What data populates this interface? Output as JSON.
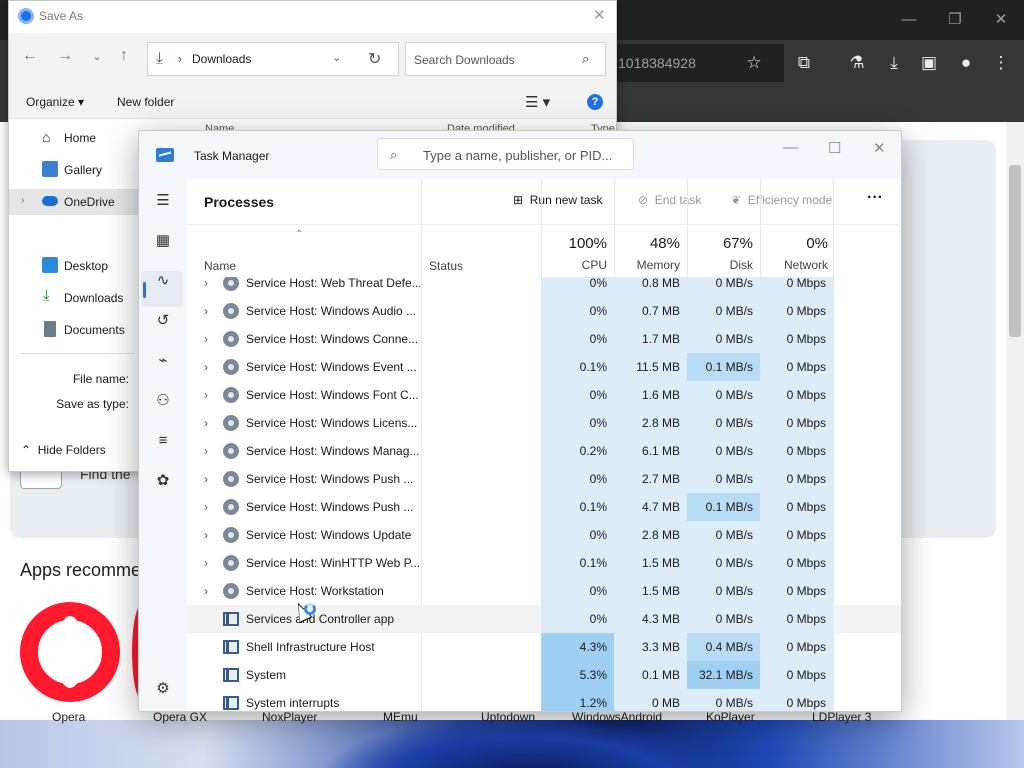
{
  "chrome": {
    "omnibox_text": "1018384928",
    "find_text": "Find the",
    "apps_heading": "Apps recomme",
    "apps": [
      "Opera",
      "Opera GX",
      "NoxPlayer",
      "MEmu",
      "Uptodown",
      "WindowsAndroid",
      "KoPlayer",
      "LDPlayer 3"
    ]
  },
  "save_as": {
    "title": "Save As",
    "path": "Downloads",
    "search_placeholder": "Search Downloads",
    "organize": "Organize",
    "new_folder": "New folder",
    "columns": [
      "Name",
      "Date modified",
      "Type"
    ],
    "sidebar": [
      {
        "label": "Home"
      },
      {
        "label": "Gallery"
      },
      {
        "label": "OneDrive"
      },
      {
        "label": "Desktop"
      },
      {
        "label": "Downloads"
      },
      {
        "label": "Documents"
      }
    ],
    "file_name_label": "File name:",
    "save_as_type_label": "Save as type:",
    "hide_folders": "Hide Folders"
  },
  "task_manager": {
    "title": "Task Manager",
    "search_placeholder": "Type a name, publisher, or PID...",
    "heading": "Processes",
    "run_new_task": "Run new task",
    "end_task": "End task",
    "efficiency_mode": "Efficiency mode",
    "columns": {
      "name": "Name",
      "status": "Status",
      "cpu_pct": "100%",
      "cpu": "CPU",
      "memory_pct": "48%",
      "memory": "Memory",
      "disk_pct": "67%",
      "disk": "Disk",
      "network_pct": "0%",
      "network": "Network"
    },
    "rows": [
      {
        "name": "Service Host: Web Threat Defe...",
        "cpu": "0%",
        "memory": "0.8 MB",
        "disk": "0 MB/s",
        "network": "0 Mbps",
        "group": true
      },
      {
        "name": "Service Host: Windows Audio ...",
        "cpu": "0%",
        "memory": "0.7 MB",
        "disk": "0 MB/s",
        "network": "0 Mbps",
        "group": true
      },
      {
        "name": "Service Host: Windows Conne...",
        "cpu": "0%",
        "memory": "1.7 MB",
        "disk": "0 MB/s",
        "network": "0 Mbps",
        "group": true
      },
      {
        "name": "Service Host: Windows Event ...",
        "cpu": "0.1%",
        "memory": "11.5 MB",
        "disk": "0.1 MB/s",
        "network": "0 Mbps",
        "group": true
      },
      {
        "name": "Service Host: Windows Font C...",
        "cpu": "0%",
        "memory": "1.6 MB",
        "disk": "0 MB/s",
        "network": "0 Mbps",
        "group": true
      },
      {
        "name": "Service Host: Windows Licens...",
        "cpu": "0%",
        "memory": "2.8 MB",
        "disk": "0 MB/s",
        "network": "0 Mbps",
        "group": true
      },
      {
        "name": "Service Host: Windows Manag...",
        "cpu": "0.2%",
        "memory": "6.1 MB",
        "disk": "0 MB/s",
        "network": "0 Mbps",
        "group": true
      },
      {
        "name": "Service Host: Windows Push ...",
        "cpu": "0%",
        "memory": "2.7 MB",
        "disk": "0 MB/s",
        "network": "0 Mbps",
        "group": true
      },
      {
        "name": "Service Host: Windows Push ...",
        "cpu": "0.1%",
        "memory": "4.7 MB",
        "disk": "0.1 MB/s",
        "network": "0 Mbps",
        "group": true
      },
      {
        "name": "Service Host: Windows Update",
        "cpu": "0%",
        "memory": "2.8 MB",
        "disk": "0 MB/s",
        "network": "0 Mbps",
        "group": true
      },
      {
        "name": "Service Host: WinHTTP Web P...",
        "cpu": "0.1%",
        "memory": "1.5 MB",
        "disk": "0 MB/s",
        "network": "0 Mbps",
        "group": true
      },
      {
        "name": "Service Host: Workstation",
        "cpu": "0%",
        "memory": "1.5 MB",
        "disk": "0 MB/s",
        "network": "0 Mbps",
        "group": true
      },
      {
        "name": "Services and Controller app",
        "cpu": "0%",
        "memory": "4.3 MB",
        "disk": "0 MB/s",
        "network": "0 Mbps",
        "group": false,
        "hover": true
      },
      {
        "name": "Shell Infrastructure Host",
        "cpu": "4.3%",
        "memory": "3.3 MB",
        "disk": "0.4 MB/s",
        "network": "0 Mbps",
        "group": false
      },
      {
        "name": "System",
        "cpu": "5.3%",
        "memory": "0.1 MB",
        "disk": "32.1 MB/s",
        "network": "0 Mbps",
        "group": false
      },
      {
        "name": "System interrupts",
        "cpu": "1.2%",
        "memory": "0 MB",
        "disk": "0 MB/s",
        "network": "0 Mbps",
        "group": false
      }
    ]
  },
  "colors": {
    "heat_light": "#dcecf9",
    "heat_mid": "#b8dcf6",
    "heat_strong": "#9fd0f4",
    "accent": "#2f6fd0"
  }
}
